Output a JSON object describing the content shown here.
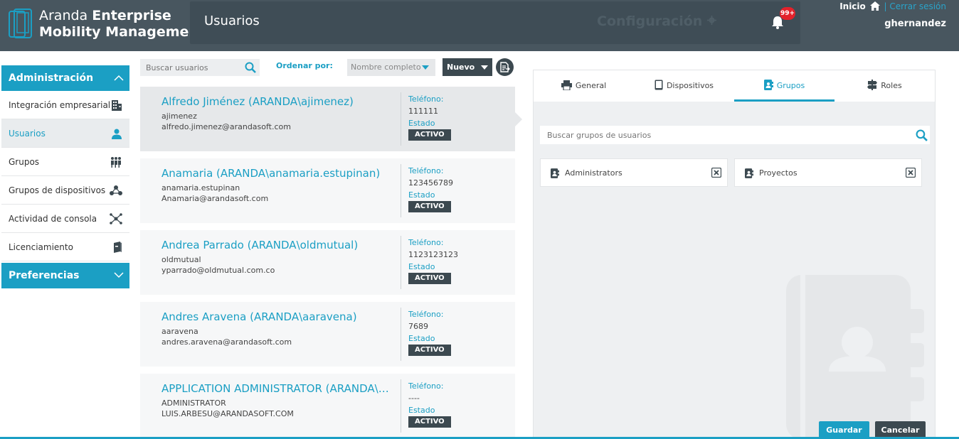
{
  "app": {
    "name_light": "Aranda",
    "name_bold": "Enterprise",
    "name_line2": "Mobility Management"
  },
  "header": {
    "title": "Usuarios",
    "config_label": "Configuración",
    "notifications_badge": "99+",
    "home_link": "Inicio",
    "separator": "|",
    "logout_link": "Cerrar sesión",
    "username": "ghernandez"
  },
  "sidebar": {
    "admin_section": "Administración",
    "items": [
      {
        "label": "Integración empresarial",
        "icon": "building-icon"
      },
      {
        "label": "Usuarios",
        "icon": "user-icon"
      },
      {
        "label": "Grupos",
        "icon": "group-icon"
      },
      {
        "label": "Grupos de dispositivos",
        "icon": "device-group-icon"
      },
      {
        "label": "Actividad de consola",
        "icon": "network-icon"
      },
      {
        "label": "Licenciamiento",
        "icon": "license-icon"
      }
    ],
    "pref_section": "Preferencias"
  },
  "toolbar": {
    "search_placeholder": "Buscar usuarios",
    "order_label": "Ordenar por:",
    "order_value": "Nombre completo",
    "new_label": "Nuevo"
  },
  "users": [
    {
      "name": "Alfredo Jiménez (ARANDA\\ajimenez)",
      "login": "ajimenez",
      "email": "alfredo.jimenez@arandasoft.com",
      "phone_label": "Teléfono:",
      "phone": "111111",
      "state_label": "Estado",
      "status": "ACTIVO"
    },
    {
      "name": "Anamaria (ARANDA\\anamaria.estupinan)",
      "login": "anamaria.estupinan",
      "email": "Anamaria@arandasoft.com",
      "phone_label": "Teléfono:",
      "phone": "123456789",
      "state_label": "Estado",
      "status": "ACTIVO"
    },
    {
      "name": "Andrea Parrado (ARANDA\\oldmutual)",
      "login": "oldmutual",
      "email": "yparrado@oldmutual.com.co",
      "phone_label": "Teléfono:",
      "phone": "1123123123",
      "state_label": "Estado",
      "status": "ACTIVO"
    },
    {
      "name": "Andres Aravena (ARANDA\\aaravena)",
      "login": "aaravena",
      "email": "andres.aravena@arandasoft.com",
      "phone_label": "Teléfono:",
      "phone": "7689",
      "state_label": "Estado",
      "status": "ACTIVO"
    },
    {
      "name": "APPLICATION ADMINISTRATOR (ARANDA\\AD...",
      "login": "ADMINISTRATOR",
      "email": "LUIS.ARBESU@ARANDASOFT.COM",
      "phone_label": "Teléfono:",
      "phone": "----",
      "state_label": "Estado",
      "status": "ACTIVO"
    }
  ],
  "detail": {
    "tabs": [
      {
        "label": "General",
        "icon": "printer-icon"
      },
      {
        "label": "Dispositivos",
        "icon": "tablet-icon"
      },
      {
        "label": "Grupos",
        "icon": "contacts-icon"
      },
      {
        "label": "Roles",
        "icon": "roles-icon"
      }
    ],
    "active_tab": "Grupos",
    "search_placeholder": "Buscar grupos de usuarios",
    "groups": [
      {
        "name": "Administrators"
      },
      {
        "name": "Proyectos"
      }
    ],
    "save_label": "Guardar",
    "cancel_label": "Cancelar"
  },
  "colors": {
    "accent": "#1b9fc4",
    "header": "#48565f",
    "dark_button": "#3c4950",
    "badge": "#e3222b"
  }
}
